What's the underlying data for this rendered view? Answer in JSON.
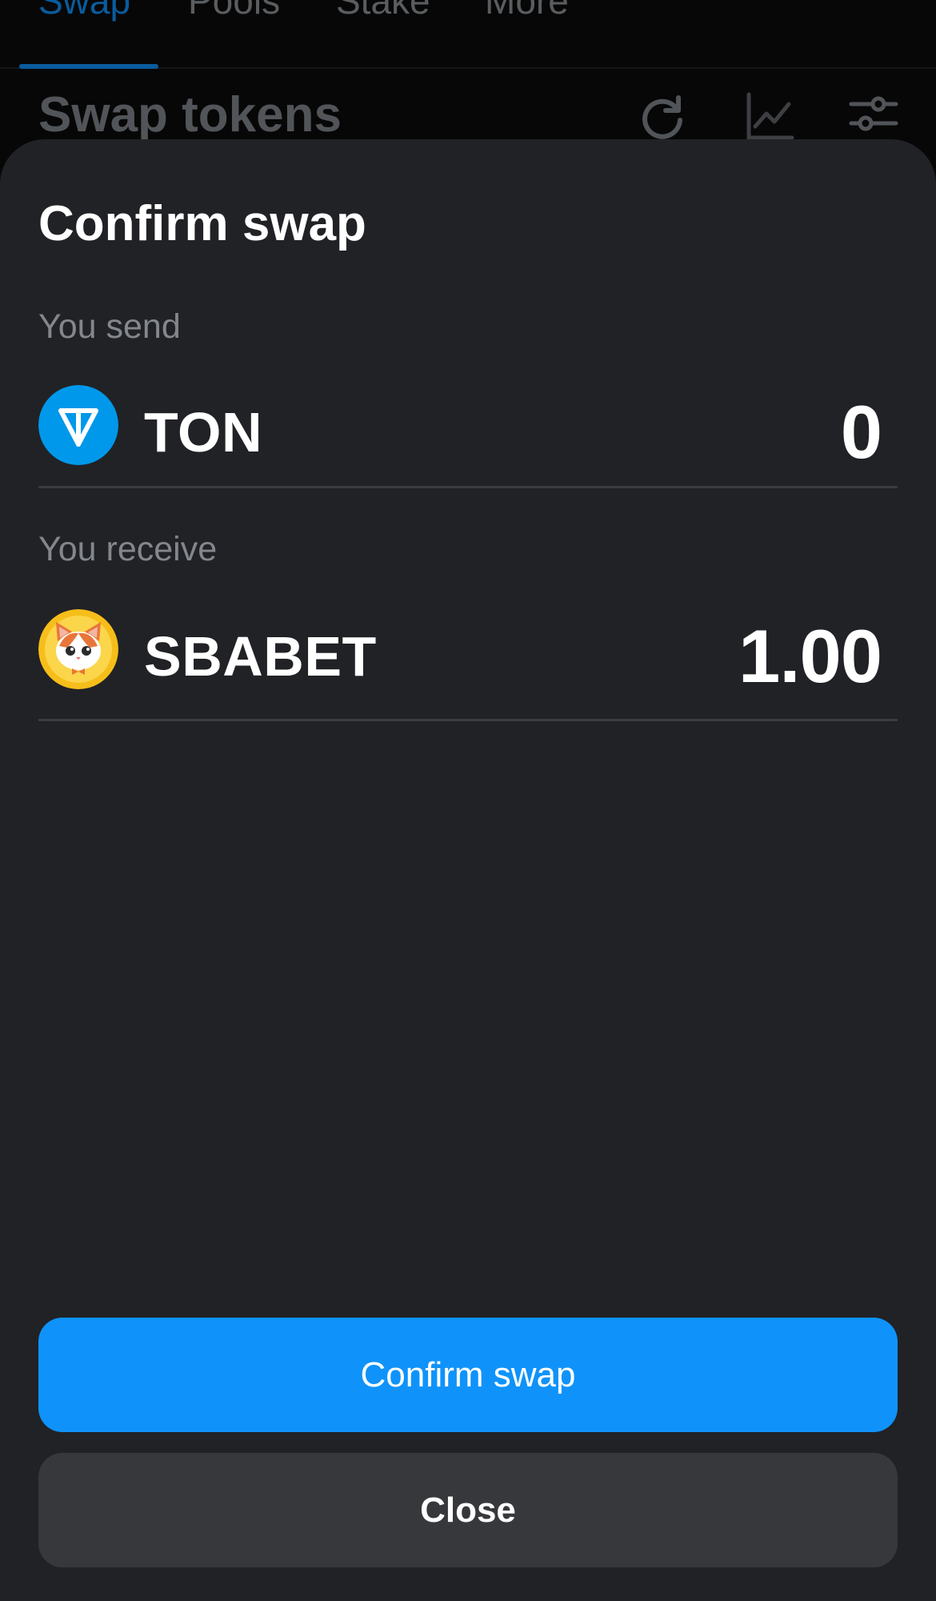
{
  "nav": {
    "tabs": [
      {
        "label": "Swap",
        "active": true
      },
      {
        "label": "Pools",
        "active": false
      },
      {
        "label": "Stake",
        "active": false
      },
      {
        "label": "More",
        "active": false
      }
    ]
  },
  "background_header": {
    "title": "Swap tokens",
    "icons": [
      "refresh-icon",
      "chart-icon",
      "sliders-icon"
    ]
  },
  "sheet": {
    "title": "Confirm swap",
    "send": {
      "label": "You send",
      "token": "TON",
      "amount": "0",
      "icon": "ton-logo-icon"
    },
    "receive": {
      "label": "You receive",
      "token": "SBABET",
      "amount": "1.00",
      "icon": "sbabet-cat-logo-icon"
    },
    "confirm_label": "Confirm swap",
    "close_label": "Close"
  },
  "colors": {
    "accent": "#0F93FA",
    "sheet_bg": "#212226",
    "close_bg": "#36383C",
    "ton_blue": "#0098EA",
    "sbabet_gold": "#F6BE1A"
  }
}
